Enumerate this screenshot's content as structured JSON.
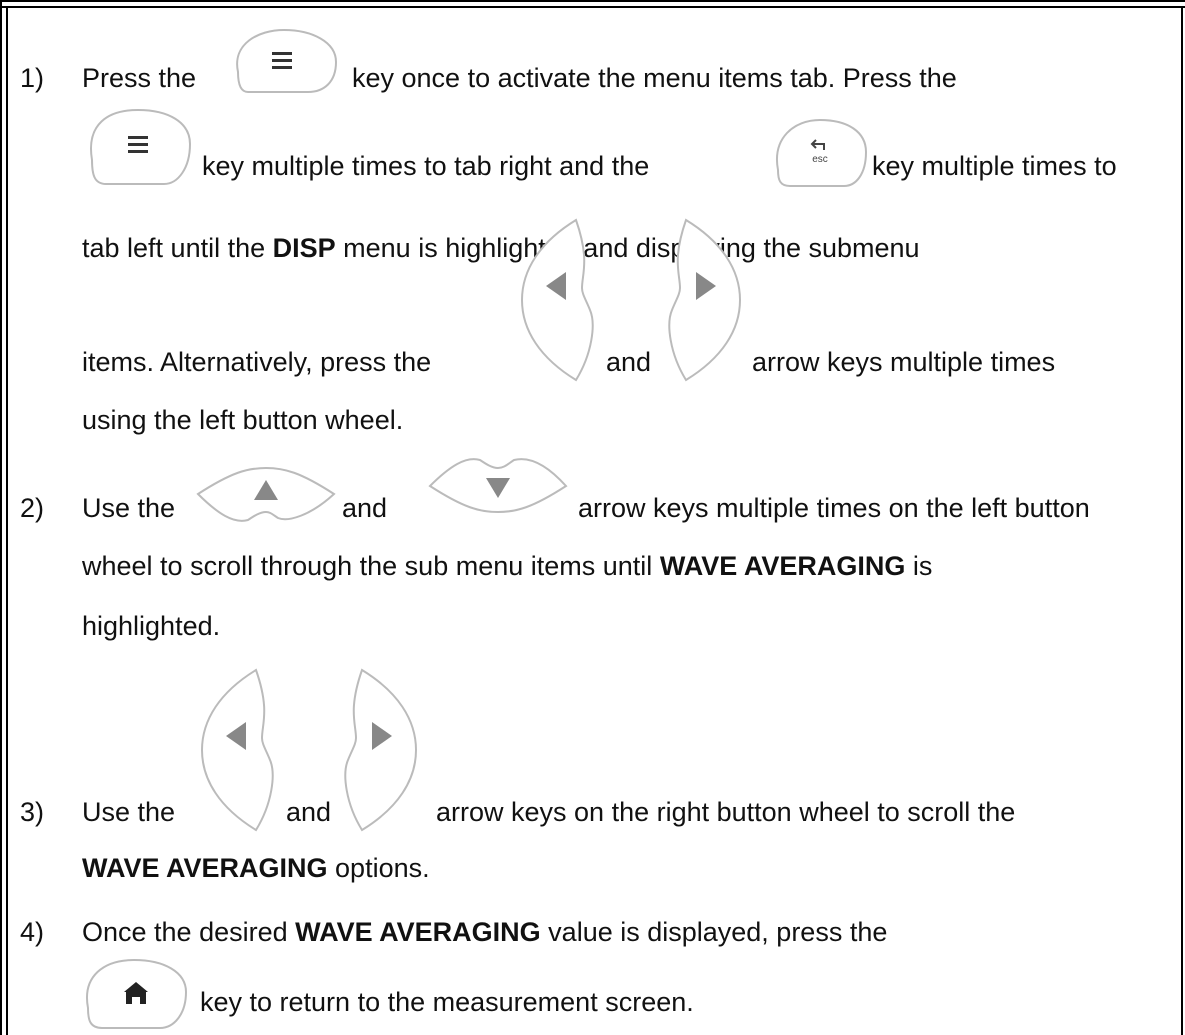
{
  "steps": [
    {
      "number": "1)",
      "lines": {
        "l1a": "Press the",
        "l1b": "key once to activate the menu items tab.  Press the",
        "l2a": "key multiple times to tab right and the",
        "l2b": "key multiple times to",
        "l3a": "tab left until the ",
        "l3b": "DISP",
        "l3c": " menu is highlighted and displaying the submenu",
        "l4a": "items.  Alternatively, press the",
        "l4b": "and",
        "l4c": "arrow keys multiple times",
        "l5": "using the left button wheel."
      }
    },
    {
      "number": "2)",
      "lines": {
        "l1a": "Use the",
        "l1b": "and",
        "l1c": "arrow keys multiple times on the left button",
        "l2a": "wheel to scroll through the sub menu items until ",
        "l2b": "WAVE AVERAGING",
        "l2c": " is",
        "l3": "highlighted."
      }
    },
    {
      "number": "3)",
      "lines": {
        "l1a": "Use the",
        "l1b": "and",
        "l1c": "arrow keys on the right button wheel to scroll the",
        "l2a": "WAVE AVERAGING",
        "l2b": " options."
      }
    },
    {
      "number": "4)",
      "lines": {
        "l1a": "Once the desired ",
        "l1b": "WAVE AVERAGING",
        "l1c": " value is displayed, press the",
        "l2": "key to return to the measurement screen."
      }
    }
  ],
  "keys": {
    "esc_label": "esc"
  },
  "icons": [
    "menu-key-icon",
    "esc-key-icon",
    "left-arrow-key-icon",
    "right-arrow-key-icon",
    "up-arrow-key-icon",
    "down-arrow-key-icon",
    "home-key-icon"
  ]
}
